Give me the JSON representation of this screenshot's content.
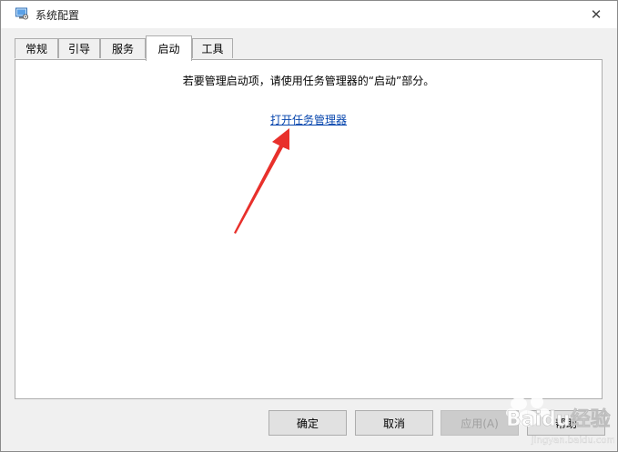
{
  "window": {
    "title": "系统配置",
    "close_symbol": "✕"
  },
  "tabs": [
    {
      "label": "常规"
    },
    {
      "label": "引导"
    },
    {
      "label": "服务"
    },
    {
      "label": "启动"
    },
    {
      "label": "工具"
    }
  ],
  "active_tab": "启动",
  "panel": {
    "message": "若要管理启动项，请使用任务管理器的“启动”部分。",
    "link": "打开任务管理器"
  },
  "buttons": {
    "ok": "确定",
    "cancel": "取消",
    "apply": "应用(A)",
    "help": "帮助"
  },
  "watermark": {
    "brand": "Baidu经验",
    "site": "jingyan.baidu.com"
  },
  "colors": {
    "link": "#0645ad",
    "arrow": "#e8302b"
  },
  "icons": {
    "app": "system-config-icon",
    "close": "close-icon"
  }
}
